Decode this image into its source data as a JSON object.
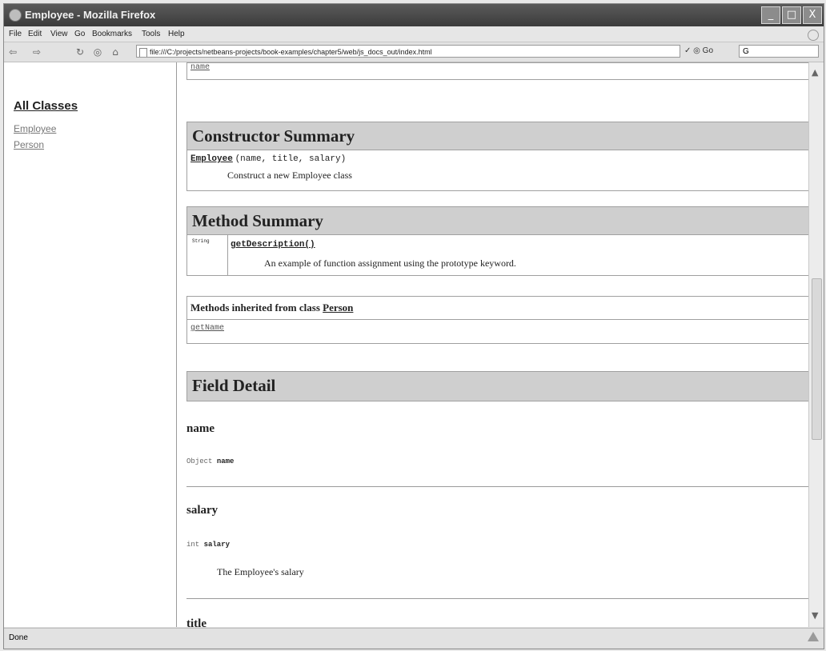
{
  "window": {
    "title": "Employee - Mozilla Firefox",
    "minimize": "_",
    "restore": "□",
    "close": "X"
  },
  "menu": [
    "File",
    "Edit",
    "View",
    "Go",
    "Bookmarks",
    "Tools",
    "Help"
  ],
  "nav": {
    "back": "⇦",
    "forward": "⇨",
    "reload": "↻",
    "stop": "◎",
    "home": "⌂",
    "url": "file:///C:/projects/netbeans-projects/book-examples/chapter5/web/js_docs_out/index.html",
    "go": "Go",
    "search_value": "G"
  },
  "sidebar": {
    "heading": "All Classes",
    "classes": [
      "Employee",
      "Person"
    ]
  },
  "main": {
    "top_fragment": "name",
    "constructor_summary": {
      "title": "Constructor Summary",
      "signature_name": "Employee",
      "signature_params": "(name, title, salary)",
      "description": "Construct a new Employee class"
    },
    "method_summary": {
      "title": "Method Summary",
      "return_type": "String",
      "method": "getDescription()",
      "description": "An example of function assignment using the prototype keyword."
    },
    "inherited": {
      "label": "Methods inherited from class",
      "class_name": "Person",
      "method": "getName"
    },
    "field_detail": {
      "title": "Field Detail",
      "fields": [
        {
          "name": "name",
          "type": "Object",
          "decl_name": "name",
          "description": ""
        },
        {
          "name": "salary",
          "type": "int",
          "decl_name": "salary",
          "description": "The Employee's salary"
        },
        {
          "name": "title"
        }
      ]
    }
  },
  "status": {
    "text": "Done"
  }
}
